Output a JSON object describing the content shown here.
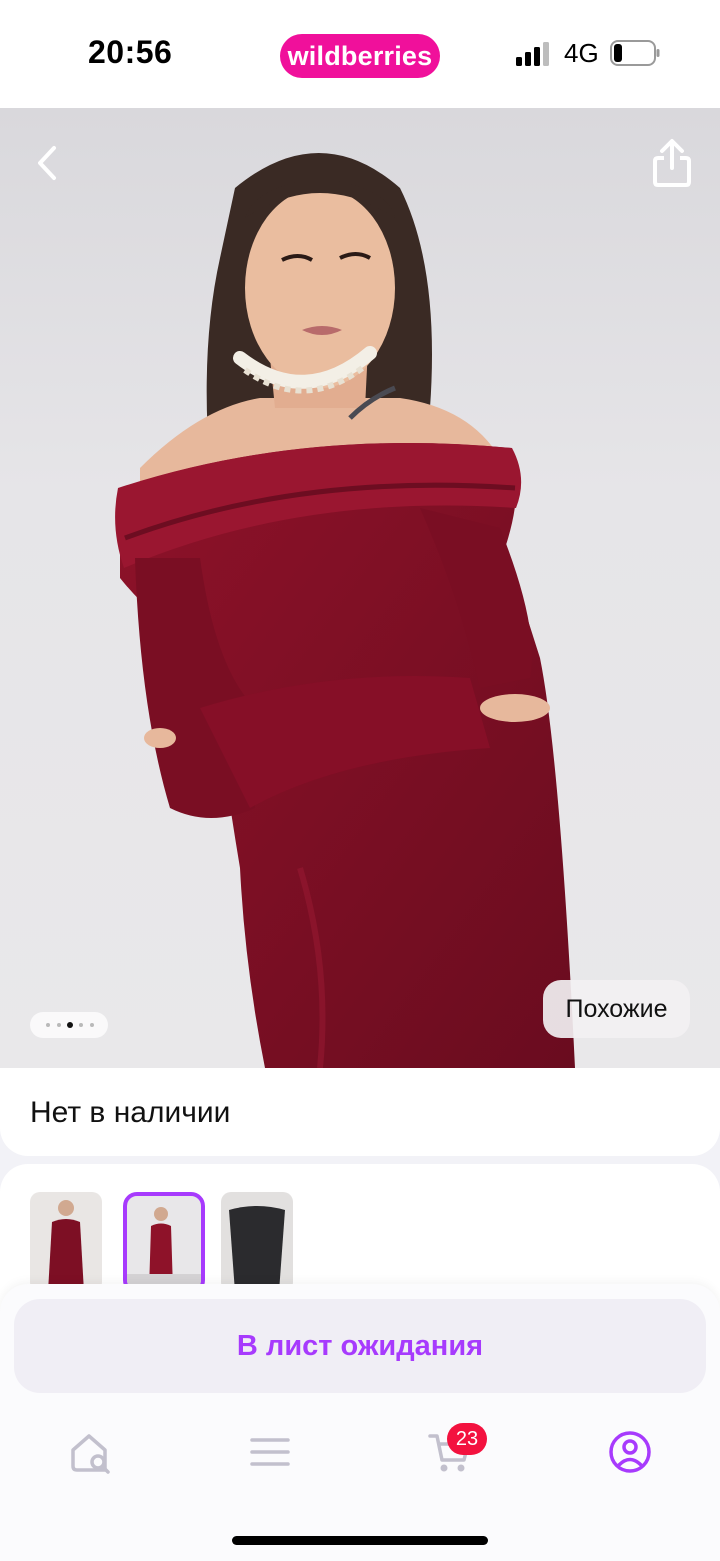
{
  "status_bar": {
    "time": "20:56",
    "brand": "wildberries",
    "network": "4G"
  },
  "hero": {
    "back_icon": "chevron-left-icon",
    "share_icon": "share-icon",
    "similar_label": "Похожие",
    "image_count": 5,
    "active_image_index": 2
  },
  "product": {
    "availability": "Нет в наличии"
  },
  "actions": {
    "waitlist_label": "В лист ожидания"
  },
  "tabbar": {
    "items": [
      "home-search-icon",
      "menu-icon",
      "cart-icon",
      "profile-icon"
    ],
    "cart_count": "23"
  },
  "colors": {
    "brand": "#f0109b",
    "accent": "#a73afd",
    "badge": "#f3123f",
    "dress": "#7d0f24"
  }
}
